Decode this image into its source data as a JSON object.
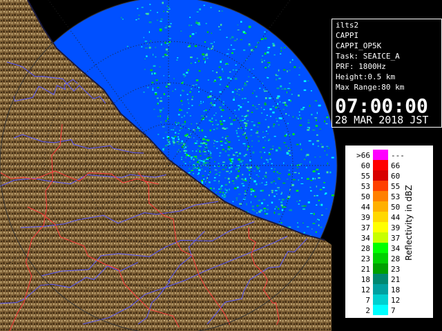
{
  "info": {
    "station": "ilts2",
    "product": "CAPPI",
    "product_code": "CAPPI_OP5K",
    "task": "Task: SEAICE_A",
    "prf": "PRF: 1800Hz",
    "height": "Height:0.5 km",
    "max_range": "Max Range:80 km",
    "time": "07:00:00",
    "date": "28 MAR 2018 JST"
  },
  "legend": {
    "unit_label": "Reflectivity in dBZ",
    "rows": [
      {
        "lo": ">66",
        "hi": "---",
        "color": "#ff00ff"
      },
      {
        "lo": "60",
        "hi": "66",
        "color": "#ff0000"
      },
      {
        "lo": "55",
        "hi": "60",
        "color": "#d80000"
      },
      {
        "lo": "53",
        "hi": "55",
        "color": "#ff4000"
      },
      {
        "lo": "50",
        "hi": "53",
        "color": "#ff8000"
      },
      {
        "lo": "44",
        "hi": "50",
        "color": "#ffb000"
      },
      {
        "lo": "39",
        "hi": "44",
        "color": "#ffd800"
      },
      {
        "lo": "37",
        "hi": "39",
        "color": "#ffff00"
      },
      {
        "lo": "34",
        "hi": "37",
        "color": "#c8ff00"
      },
      {
        "lo": "28",
        "hi": "34",
        "color": "#00ff00"
      },
      {
        "lo": "23",
        "hi": "28",
        "color": "#00d000"
      },
      {
        "lo": "21",
        "hi": "23",
        "color": "#00a000"
      },
      {
        "lo": "18",
        "hi": "21",
        "color": "#008870"
      },
      {
        "lo": "12",
        "hi": "18",
        "color": "#00a0a0"
      },
      {
        "lo": "7",
        "hi": "12",
        "color": "#00d0d0"
      },
      {
        "lo": "2",
        "hi": "7",
        "color": "#00ffff"
      }
    ]
  },
  "colors": {
    "sea_echo_background": "#0050ff",
    "land": "#8a6a3e",
    "river": "#5a5aff",
    "boundary": "#ff3a3a"
  }
}
